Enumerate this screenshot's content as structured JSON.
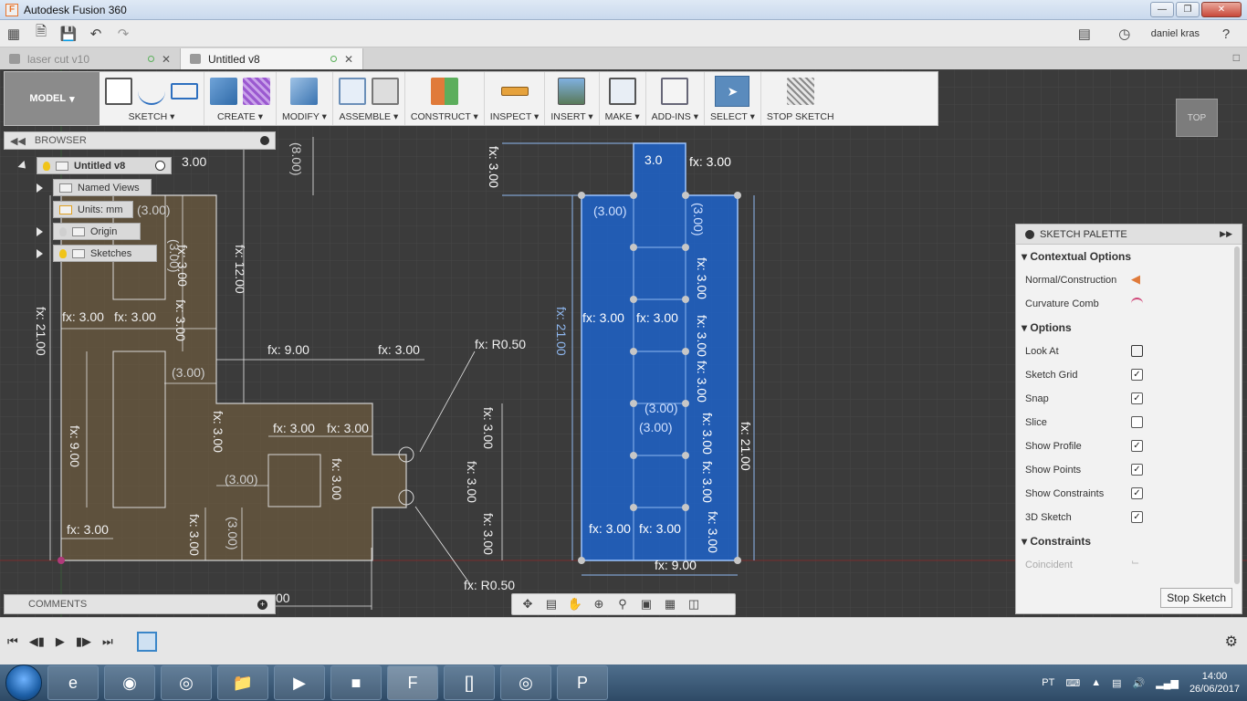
{
  "window": {
    "title": "Autodesk Fusion 360",
    "app_logo": "F"
  },
  "quick_access": {
    "user": "daniel kras",
    "help": "?"
  },
  "tabs": [
    {
      "label": "laser cut v10",
      "active": false
    },
    {
      "label": "Untitled v8",
      "active": true
    }
  ],
  "toolbar": {
    "mode": "MODEL",
    "groups": [
      {
        "label": "SKETCH"
      },
      {
        "label": "CREATE"
      },
      {
        "label": "MODIFY"
      },
      {
        "label": "ASSEMBLE"
      },
      {
        "label": "CONSTRUCT"
      },
      {
        "label": "INSPECT"
      },
      {
        "label": "INSERT"
      },
      {
        "label": "MAKE"
      },
      {
        "label": "ADD-INS"
      },
      {
        "label": "SELECT"
      },
      {
        "label": "STOP SKETCH"
      }
    ]
  },
  "browser": {
    "title": "BROWSER",
    "items": [
      {
        "label": "Untitled v8"
      },
      {
        "label": "Named Views"
      },
      {
        "label": "Units: mm"
      },
      {
        "label": "Origin"
      },
      {
        "label": "Sketches"
      }
    ]
  },
  "comments": {
    "title": "COMMENTS"
  },
  "viewcube": {
    "label": "TOP"
  },
  "sketch_palette": {
    "title": "SKETCH PALETTE",
    "sections": {
      "contextual": "Contextual Options",
      "options": "Options",
      "constraints": "Constraints"
    },
    "contextual_rows": [
      {
        "label": "Normal/Construction"
      },
      {
        "label": "Curvature Comb"
      }
    ],
    "option_rows": [
      {
        "label": "Look At",
        "type": "icon"
      },
      {
        "label": "Sketch Grid",
        "checked": true
      },
      {
        "label": "Snap",
        "checked": true
      },
      {
        "label": "Slice",
        "checked": false
      },
      {
        "label": "Show Profile",
        "checked": true
      },
      {
        "label": "Show Points",
        "checked": true
      },
      {
        "label": "Show Constraints",
        "checked": true
      },
      {
        "label": "3D Sketch",
        "checked": true
      }
    ],
    "constraint_rows": [
      {
        "label": "Coincident"
      }
    ],
    "stop_button": "Stop Sketch"
  },
  "dimensions": {
    "left": [
      "3.00",
      "(3.00)",
      "(3.00)",
      "fx: 12.00",
      "fx: 21.00",
      "fx: 3.00",
      "fx: 3.00",
      "fx: 3.00",
      "fx: 3.00",
      "fx: 9.00",
      "(3.00)",
      "fx: 9.00",
      "fx: 3.00",
      "fx: R0.50",
      "fx: 3.00",
      "fx: 3.00",
      "fx: 3.00",
      "(3.00)",
      "fx: 3.00",
      "fx: 3.00",
      "fx: 3.00",
      "(3.00)",
      "fx: 3.00",
      "fx: 3.00",
      "fx: R0.50",
      "(8.00)",
      "00"
    ],
    "right": [
      "fx: 3.00",
      "3.0",
      "fx: 3.00",
      "(3.00)",
      "(3.00)",
      "fx: 21.00",
      "fx: 3.00",
      "fx: 3.00",
      "fx: 3.00",
      "fx: 3.00",
      "(3.00)",
      "(3.00)",
      "fx: 21.00",
      "fx: 3.00",
      "fx: 3.00",
      "fx: 9.00",
      "fx: 3.00",
      "fx: 3.00"
    ]
  },
  "taskbar": {
    "language": "PT",
    "time": "14:00",
    "date": "26/06/2017"
  },
  "colors": {
    "sketch_blue": "#3f7fd8",
    "profile_orange": "#6b5a3f",
    "grid": "#454545"
  }
}
